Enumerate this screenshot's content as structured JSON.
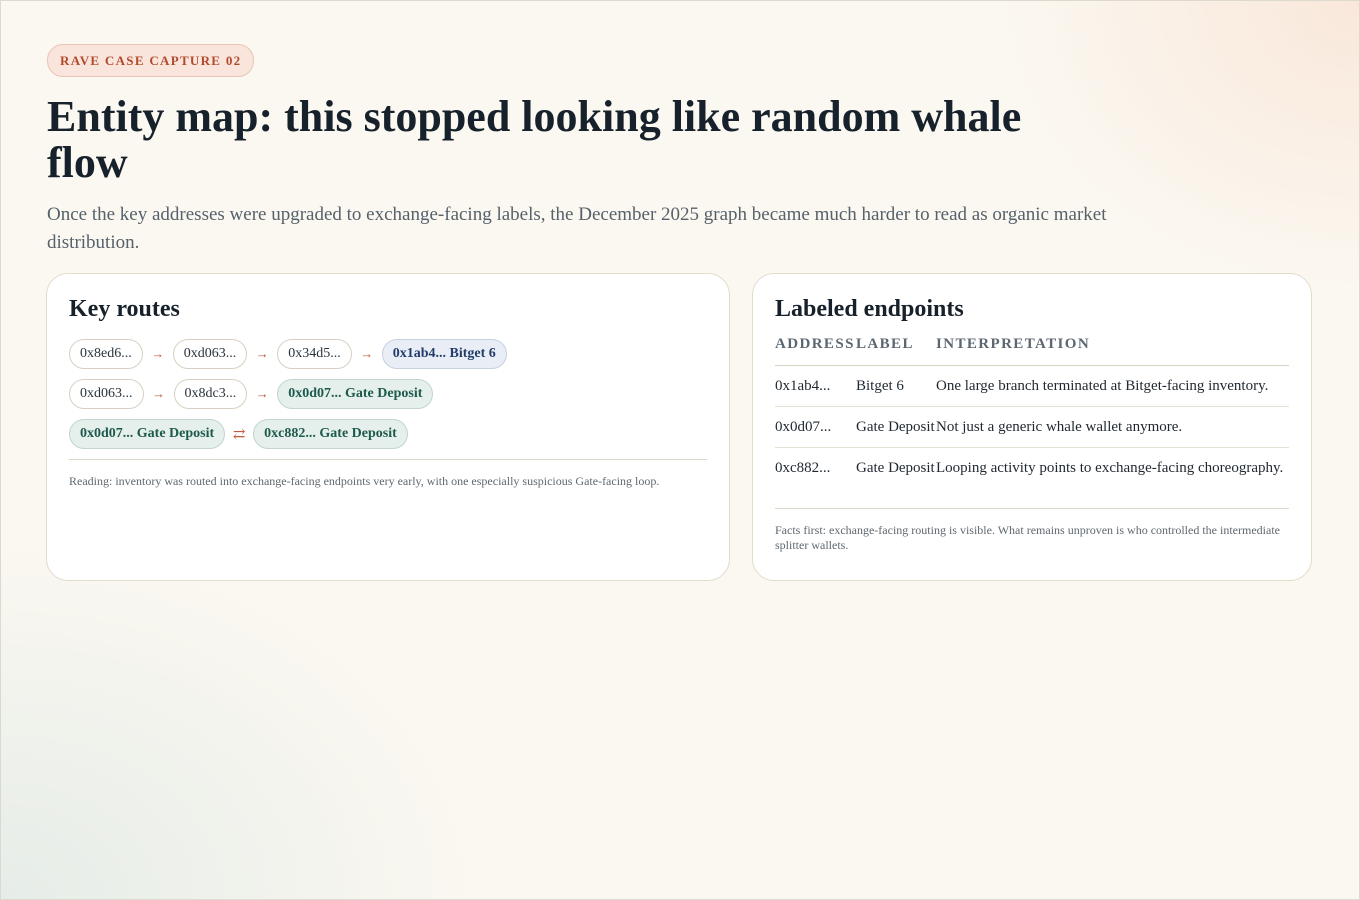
{
  "badge": "RAVE CASE CAPTURE 02",
  "title": "Entity map: this stopped looking like random whale flow",
  "subtitle": "Once the key addresses were upgraded to exchange-facing labels, the December 2025 graph became much harder to read as organic market distribution.",
  "routes_card": {
    "title": "Key routes",
    "routes": [
      {
        "nodes": [
          {
            "text": "0x8ed6...",
            "kind": "plain"
          },
          {
            "text": "0xd063...",
            "kind": "plain"
          },
          {
            "text": "0x34d5...",
            "kind": "plain"
          },
          {
            "text": "0x1ab4... Bitget 6",
            "kind": "bitget"
          }
        ],
        "connectors": [
          "→",
          "→",
          "→"
        ]
      },
      {
        "nodes": [
          {
            "text": "0xd063...",
            "kind": "plain"
          },
          {
            "text": "0x8dc3...",
            "kind": "plain"
          },
          {
            "text": "0x0d07... Gate Deposit",
            "kind": "gate"
          }
        ],
        "connectors": [
          "→",
          "→"
        ]
      },
      {
        "nodes": [
          {
            "text": "0x0d07... Gate Deposit",
            "kind": "gate"
          },
          {
            "text": "0xc882... Gate Deposit",
            "kind": "gate"
          }
        ],
        "connectors": [
          "⇄"
        ]
      }
    ],
    "note": "Reading: inventory was routed into exchange-facing endpoints very early, with one especially suspicious Gate-facing loop."
  },
  "endpoints_card": {
    "title": "Labeled endpoints",
    "columns": [
      "ADDRESS",
      "LABEL",
      "INTERPRETATION"
    ],
    "rows": [
      [
        "0x1ab4...",
        "Bitget 6",
        "One large branch terminated at Bitget-facing inventory."
      ],
      [
        "0x0d07...",
        "Gate Deposit",
        "Not just a generic whale wallet anymore."
      ],
      [
        "0xc882...",
        "Gate Deposit",
        "Looping activity points to exchange-facing choreography."
      ]
    ],
    "note": "Facts first: exchange-facing routing is visible. What remains unproven is who controlled the intermediate splitter wallets."
  },
  "colors": {
    "accent": "#b24a2c",
    "bitget": "#243c6b",
    "gate": "#1e5a4c",
    "background": "#fbf8f1"
  }
}
